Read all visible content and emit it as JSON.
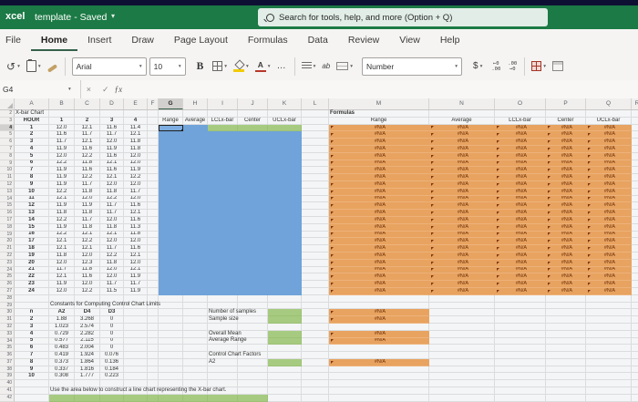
{
  "titlebar": {
    "app_name": "xcel",
    "document_title": "template - Saved",
    "search_placeholder": "Search for tools, help, and more (Option + Q)"
  },
  "ribbon": {
    "tabs": [
      {
        "label": "File"
      },
      {
        "label": "Home"
      },
      {
        "label": "Insert"
      },
      {
        "label": "Draw"
      },
      {
        "label": "Page Layout"
      },
      {
        "label": "Formulas"
      },
      {
        "label": "Data"
      },
      {
        "label": "Review"
      },
      {
        "label": "View"
      },
      {
        "label": "Help"
      }
    ],
    "active_tab": "Home"
  },
  "toolbar": {
    "font_name": "Arial",
    "font_size": "10",
    "bold_label": "B",
    "font_color_label": "A",
    "number_format": "Number",
    "currency_label": "$",
    "wrap_label": "ab",
    "increase_decimal_top": "←0",
    "increase_decimal_bottom": ".00",
    "decrease_decimal_top": ".00",
    "decrease_decimal_bottom": "→0"
  },
  "icons": {
    "undo": "↺",
    "chevron": "▾",
    "more": "…",
    "cancel": "×",
    "confirm": "✓",
    "fx": "ƒx",
    "search": "magnifier"
  },
  "formula_bar": {
    "name_box": "G4",
    "formula_value": ""
  },
  "sheet": {
    "title": "X-bar Chart",
    "formulas_label": "Formulas",
    "na_value": "#N/A",
    "active_cell": "G4",
    "column_letters": [
      "A",
      "B",
      "C",
      "D",
      "E",
      "F",
      "G",
      "H",
      "I",
      "J",
      "K",
      "L",
      "M",
      "N",
      "O",
      "P",
      "Q",
      "R"
    ],
    "row_numbers_start": 2,
    "row_numbers_end": 42,
    "data_table": {
      "headers": [
        "HOUR",
        "1",
        "2",
        "3",
        "4"
      ],
      "rows": [
        [
          "1",
          "12.0",
          "12.1",
          "11.6",
          "11.4"
        ],
        [
          "2",
          "11.6",
          "11.7",
          "11.7",
          "12.1"
        ],
        [
          "3",
          "11.7",
          "12.1",
          "12.0",
          "11.8"
        ],
        [
          "4",
          "11.9",
          "11.6",
          "11.9",
          "11.8"
        ],
        [
          "5",
          "12.0",
          "12.2",
          "11.6",
          "12.0"
        ],
        [
          "6",
          "12.2",
          "11.8",
          "12.1",
          "12.0"
        ],
        [
          "7",
          "11.9",
          "11.6",
          "11.6",
          "11.9"
        ],
        [
          "8",
          "11.9",
          "12.2",
          "12.1",
          "12.2"
        ],
        [
          "9",
          "11.9",
          "11.7",
          "12.0",
          "12.0"
        ],
        [
          "10",
          "12.2",
          "11.8",
          "11.8",
          "11.7"
        ],
        [
          "11",
          "12.1",
          "12.0",
          "12.2",
          "12.0"
        ],
        [
          "12",
          "11.9",
          "11.9",
          "11.7",
          "11.6"
        ],
        [
          "13",
          "11.8",
          "11.8",
          "11.7",
          "12.1"
        ],
        [
          "14",
          "12.2",
          "11.7",
          "12.0",
          "11.6"
        ],
        [
          "15",
          "11.9",
          "11.8",
          "11.8",
          "11.3"
        ],
        [
          "16",
          "12.2",
          "12.1",
          "12.1",
          "11.8"
        ],
        [
          "17",
          "12.1",
          "12.2",
          "12.0",
          "12.0"
        ],
        [
          "18",
          "12.1",
          "12.1",
          "11.7",
          "11.6"
        ],
        [
          "19",
          "11.8",
          "12.0",
          "12.2",
          "12.1"
        ],
        [
          "20",
          "12.0",
          "12.3",
          "11.8",
          "12.0"
        ],
        [
          "21",
          "11.7",
          "11.8",
          "12.0",
          "12.1"
        ],
        [
          "22",
          "12.1",
          "11.6",
          "12.0",
          "11.9"
        ],
        [
          "23",
          "11.9",
          "12.0",
          "11.7",
          "11.7"
        ],
        [
          "24",
          "12.0",
          "12.2",
          "11.5",
          "11.9"
        ]
      ]
    },
    "calc_headers": [
      "Range",
      "Average",
      "LCLx-bar",
      "Center",
      "UCLx-bar"
    ],
    "formulas_headers": [
      "Range",
      "Average",
      "LCLx-bar",
      "Center",
      "UCLx-bar"
    ],
    "constants": {
      "title": "Constants for Computing Control Chart Limits",
      "headers": [
        "n",
        "A2",
        "D4",
        "D3"
      ],
      "rows": [
        [
          "2",
          "1.88",
          "3.268",
          "0"
        ],
        [
          "3",
          "1.023",
          "2.574",
          "0"
        ],
        [
          "4",
          "0.729",
          "2.282",
          "0"
        ],
        [
          "5",
          "0.577",
          "2.115",
          "0"
        ],
        [
          "6",
          "0.483",
          "2.004",
          "0"
        ],
        [
          "7",
          "0.419",
          "1.924",
          "0.076"
        ],
        [
          "8",
          "0.373",
          "1.864",
          "0.136"
        ],
        [
          "9",
          "0.337",
          "1.816",
          "0.184"
        ],
        [
          "10",
          "0.308",
          "1.777",
          "0.223"
        ]
      ]
    },
    "inputs": {
      "labels": [
        {
          "row": 30,
          "text": "Number of samples",
          "input": true,
          "result": "#N/A"
        },
        {
          "row": 31,
          "text": "Sample size",
          "input": true,
          "result": "#N/A"
        },
        {
          "row": 33,
          "text": "Overall Mean",
          "input": true,
          "result": "#N/A"
        },
        {
          "row": 34,
          "text": "Average Range",
          "input": true,
          "result": "#N/A"
        },
        {
          "row": 36,
          "text": "Control Chart Factors",
          "input": false,
          "result": null
        },
        {
          "row": 37,
          "text": "A2",
          "input": true,
          "result": "#N/A"
        }
      ]
    },
    "note": "Use the area below to construct a line chart representing the X-bar chart."
  },
  "colors": {
    "titlebar_green": "#1b7a45",
    "selection_blue": "#6fa3d9",
    "input_green": "#a6cb80",
    "warning_orange": "#e8a360",
    "error_text": "#6f3108"
  }
}
